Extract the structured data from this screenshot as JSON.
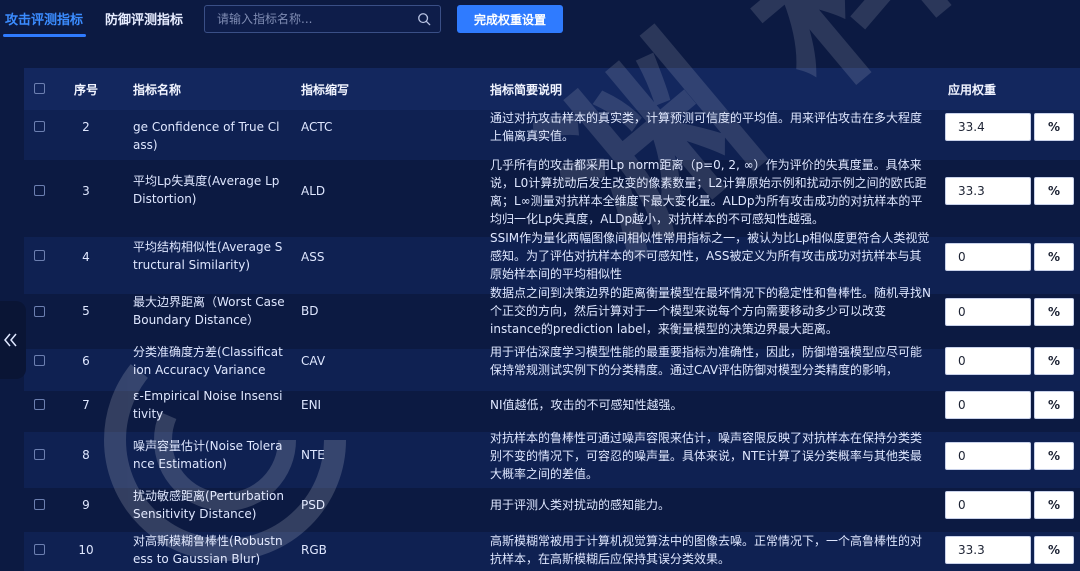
{
  "tabs": [
    {
      "label": "攻击评测指标",
      "active": true
    },
    {
      "label": "防御评测指标",
      "active": false
    }
  ],
  "search": {
    "placeholder": "请输入指标名称..."
  },
  "toolbar": {
    "complete_label": "完成权重设置"
  },
  "table": {
    "headers": [
      "序号",
      "指标名称",
      "指标缩写",
      "指标简要说明",
      "应用权重"
    ],
    "rows": [
      {
        "index": "2",
        "name": "真实类别平均置信度(Average Confidence of True Class)",
        "name_visible": "ge Confidence of True Class)",
        "abbr": "ACTC",
        "desc": "通过对抗攻击样本的真实类，计算预测可信度的平均值。用来评估攻击在多大程度上偏离真实值。",
        "weight": "33.4",
        "unit": "%"
      },
      {
        "index": "3",
        "name": "平均Lp失真度(Average Lp Distortion)",
        "abbr": "ALD",
        "desc": "几乎所有的攻击都采用Lp norm距离（p=0, 2, ∞）作为评价的失真度量。具体来说，L0计算扰动后发生改变的像素数量；L2计算原始示例和扰动示例之间的欧氏距离；L∞测量对抗样本全维度下最大变化量。ALDp为所有攻击成功的对抗样本的平均归一化Lp失真度，ALDp越小，对抗样本的不可感知性越强。",
        "weight": "33.3",
        "unit": "%"
      },
      {
        "index": "4",
        "name": "平均结构相似性(Average Structural Similarity)",
        "abbr": "ASS",
        "desc": "SSIM作为量化两幅图像间相似性常用指标之一，被认为比Lp相似度更符合人类视觉感知。为了评估对抗样本的不可感知性，ASS被定义为所有攻击成功对抗样本与其原始样本间的平均相似性",
        "weight": "0",
        "unit": "%"
      },
      {
        "index": "5",
        "name": "最大边界距离（Worst Case Boundary Distance）",
        "abbr": "BD",
        "desc": "数据点之间到决策边界的距离衡量模型在最坏情况下的稳定性和鲁棒性。随机寻找N个正交的方向，然后计算对于一个模型来说每个方向需要移动多少可以改变instance的prediction label，来衡量模型的决策边界最大距离。",
        "weight": "0",
        "unit": "%"
      },
      {
        "index": "6",
        "name": "分类准确度方差(Classification Accuracy Variance",
        "abbr": "CAV",
        "desc": "用于评估深度学习模型性能的最重要指标为准确性，因此，防御增强模型应尽可能保持常规测试实例下的分类精度。通过CAV评估防御对模型分类精度的影响，",
        "weight": "0",
        "unit": "%"
      },
      {
        "index": "7",
        "name": "ε-Empirical Noise Insensitivity",
        "abbr": "ENI",
        "desc": "NI值越低，攻击的不可感知性越强。",
        "weight": "0",
        "unit": "%"
      },
      {
        "index": "8",
        "name": "噪声容量估计(Noise Tolerance Estimation)",
        "abbr": "NTE",
        "desc": "对抗样本的鲁棒性可通过噪声容限来估计，噪声容限反映了对抗样本在保持分类类别不变的情况下，可容忍的噪声量。具体来说，NTE计算了误分类概率与其他类最大概率之间的差值。",
        "weight": "0",
        "unit": "%"
      },
      {
        "index": "9",
        "name": "扰动敏感距离(Perturbation Sensitivity Distance)",
        "abbr": "PSD",
        "desc": "用于评测人类对扰动的感知能力。",
        "weight": "0",
        "unit": "%"
      },
      {
        "index": "10",
        "name": "对高斯模糊鲁棒性(Robustness to Gaussian Blur)",
        "abbr": "RGB",
        "desc": "高斯模糊常被用于计算机视觉算法中的图像去噪。正常情况下，一个高鲁棒性的对抗样本，在高斯模糊后应保持其误分类效果。",
        "weight": "33.3",
        "unit": "%"
      }
    ]
  },
  "watermark": {
    "text": "渊 科 技"
  },
  "colors": {
    "background": "#0c1a42",
    "accent": "#2f7bff",
    "header": "#13275e",
    "row_alt": "#0f2152"
  },
  "icons": {
    "search": "search-icon",
    "collapse": "double-chevron-left-icon",
    "watermark_logo": "logo-swirl-icon"
  }
}
